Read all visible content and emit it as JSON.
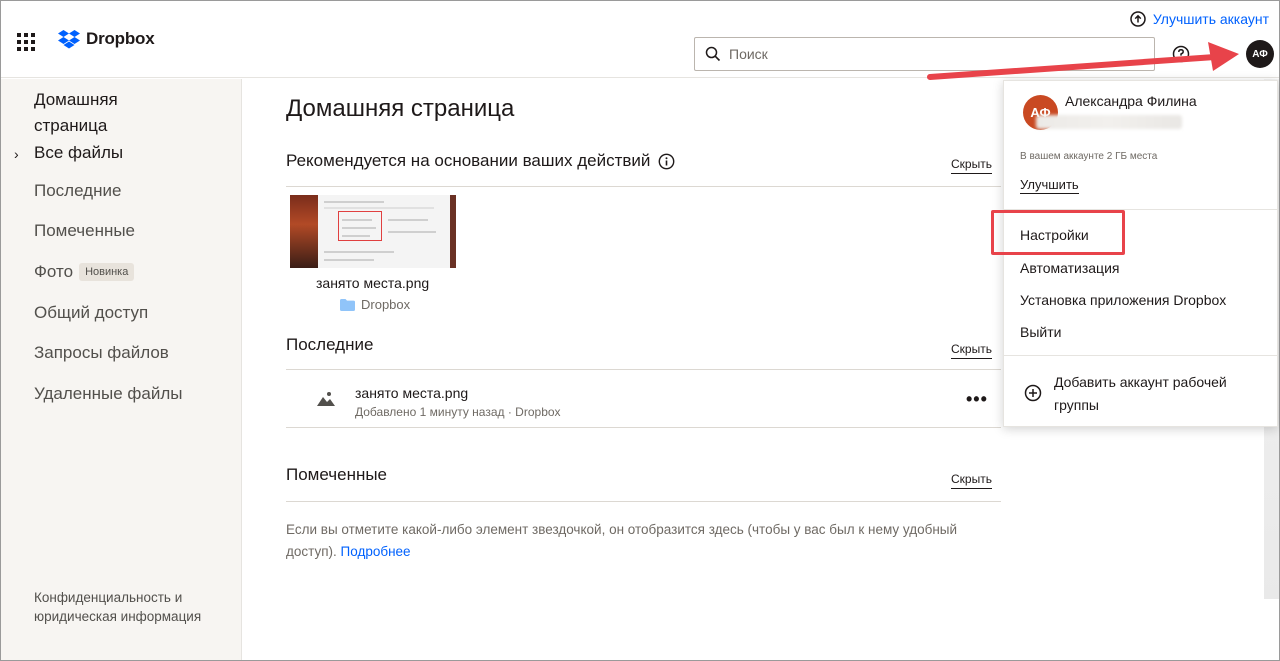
{
  "header": {
    "brand": "Dropbox",
    "upgrade_label": "Улучшить аккаунт",
    "search_placeholder": "Поиск",
    "avatar_initials": "АФ"
  },
  "sidebar": {
    "home": "Домашняя страница",
    "items": [
      {
        "label": "Все файлы"
      },
      {
        "label": "Последние"
      },
      {
        "label": "Помеченные"
      },
      {
        "label": "Фото",
        "badge": "Новинка"
      },
      {
        "label": "Общий доступ"
      },
      {
        "label": "Запросы файлов"
      },
      {
        "label": "Удаленные файлы"
      }
    ],
    "privacy": "Конфиденциальность и юридическая информация"
  },
  "main": {
    "title": "Домашняя страница",
    "recommended": {
      "title": "Рекомендуется на основании ваших действий",
      "hide": "Скрыть",
      "file_name": "занято места.png",
      "folder": "Dropbox"
    },
    "recent": {
      "title": "Последние",
      "hide": "Скрыть",
      "file_name": "занято места.png",
      "file_meta": "Добавлено 1 минуту назад · Dropbox"
    },
    "starred": {
      "title": "Помеченные",
      "hide": "Скрыть",
      "empty_text": "Если вы отметите какой-либо элемент звездочкой, он отобразится здесь (чтобы у вас был к нему удобный доступ).",
      "learn_more": "Подробнее"
    }
  },
  "account_menu": {
    "initials": "АФ",
    "name": "Александра Филина",
    "quota": "В вашем аккаунте 2 ГБ места",
    "upgrade": "Улучшить",
    "items": [
      {
        "label": "Настройки"
      },
      {
        "label": "Автоматизация"
      },
      {
        "label": "Установка приложения Dropbox"
      },
      {
        "label": "Выйти"
      }
    ],
    "add_team": "Добавить аккаунт рабочей группы"
  },
  "colors": {
    "accent": "#0061fe",
    "annotation": "#e8434a",
    "avatar_menu": "#c94922"
  }
}
